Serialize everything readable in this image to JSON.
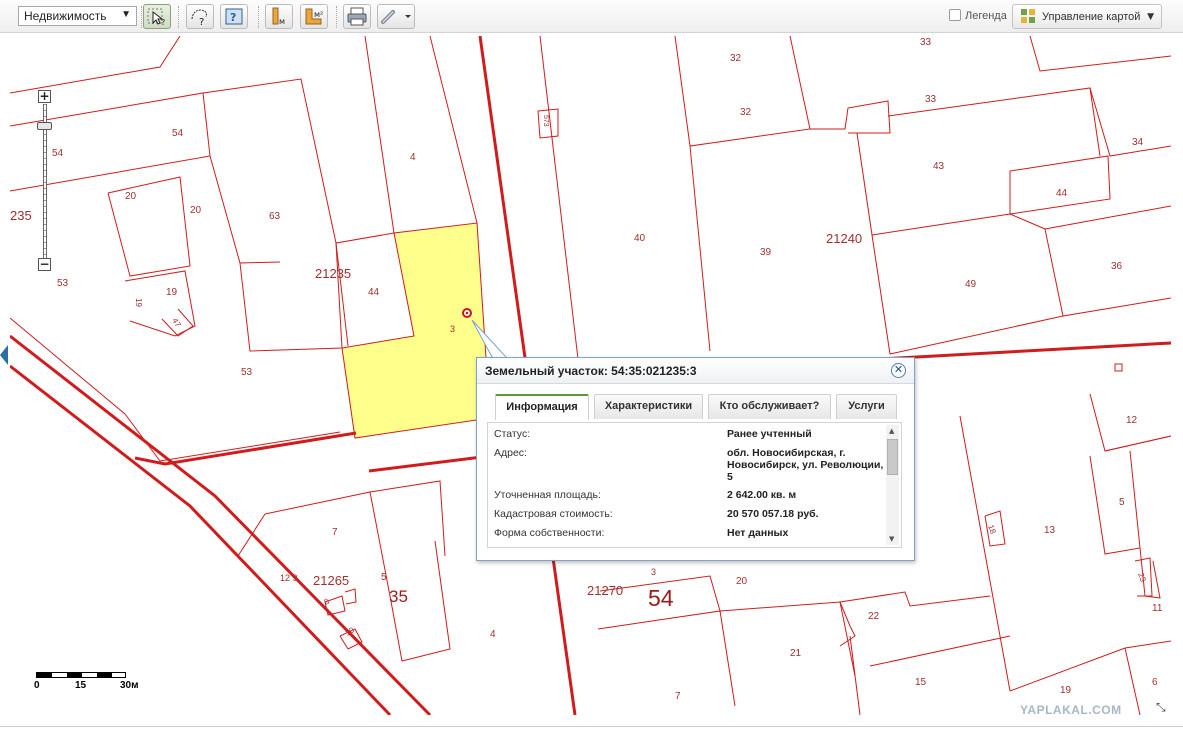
{
  "toolbar": {
    "layer_select_value": "Недвижимость",
    "legend_label": "Легенда",
    "map_control_label": "Управление картой",
    "icons": [
      "select-info-icon",
      "lasso-query-icon",
      "query-info-icon",
      "measure-length-icon",
      "measure-area-icon",
      "print-icon",
      "link-icon"
    ]
  },
  "colors": {
    "parcel_border": "#d01c1c",
    "highlight_fill": "#ffff8c",
    "label": "#a0302e",
    "popup_border": "#7fa2c7",
    "tab_active": "#5a9a3c"
  },
  "map": {
    "parcel_labels": [
      "33",
      "32",
      "32",
      "33",
      "54",
      "54",
      "573",
      "4",
      "43",
      "34",
      "20",
      "20",
      "63",
      "44",
      "21235",
      "40",
      "39",
      "21240",
      "49",
      "36",
      "235",
      "53",
      "19",
      "19",
      "47",
      "44",
      "3",
      "53",
      "12",
      "5",
      "13",
      "18",
      "23",
      "11",
      "7",
      "12 9",
      "21265",
      "8",
      "5",
      "10",
      "35",
      "4",
      "3",
      "20",
      "21270",
      "54",
      "22",
      "21",
      "15",
      "7",
      "19",
      "6"
    ],
    "scale": {
      "labels": [
        "0",
        "15",
        "30м"
      ]
    },
    "watermark": "YAPLAKAL.COM"
  },
  "popup": {
    "title": "Земельный участок: 54:35:021235:3",
    "tabs": [
      "Информация",
      "Характеристики",
      "Кто обслуживает?",
      "Услуги"
    ],
    "active_tab": "Информация",
    "rows": [
      {
        "label": "Статус:",
        "value": "Ранее учтенный"
      },
      {
        "label": "Адрес:",
        "value": "обл. Новосибирская, г. Новосибирск, ул. Революции, 5"
      },
      {
        "label": "Уточненная площадь:",
        "value": "2 642.00 кв. м"
      },
      {
        "label": "Кадастровая стоимость:",
        "value": "20 570 057.18 руб."
      },
      {
        "label": "Форма собственности:",
        "value": "Нет данных"
      }
    ]
  }
}
